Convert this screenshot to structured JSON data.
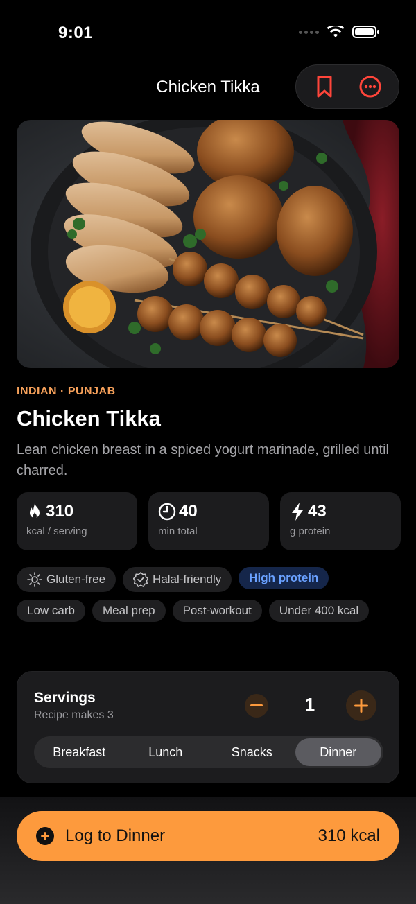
{
  "status": {
    "time": "9:01"
  },
  "nav": {
    "title": "Chicken Tikka",
    "bookmark_icon": "bookmark-icon",
    "more_icon": "more-icon"
  },
  "recipe": {
    "cuisine": "INDIAN · PUNJAB",
    "title": "Chicken Tikka",
    "description": "Lean chicken breast in a spiced yogurt marinade, grilled until charred."
  },
  "stats": [
    {
      "icon": "flame-icon",
      "value": "310",
      "label": "kcal / serving"
    },
    {
      "icon": "clock-icon",
      "value": "40",
      "label": "min total"
    },
    {
      "icon": "bolt-icon",
      "value": "43",
      "label": "g protein"
    }
  ],
  "tags": {
    "gluten_free": "Gluten-free",
    "halal": "Halal-friendly",
    "high_protein": "High protein",
    "low_carb": "Low carb",
    "meal_prep": "Meal prep",
    "post_workout": "Post-workout",
    "under_400": "Under 400 kcal"
  },
  "servings": {
    "title": "Servings",
    "subtitle": "Recipe makes 3",
    "value": "1",
    "meals": [
      "Breakfast",
      "Lunch",
      "Snacks",
      "Dinner"
    ],
    "selected_meal": "Dinner"
  },
  "cta": {
    "label": "Log to Dinner",
    "kcal": "310 kcal"
  },
  "colors": {
    "accent": "#fd9a3d",
    "brand_red": "#ff453a",
    "tag_blue": "#6aa1ff",
    "card": "#1c1c1e"
  }
}
